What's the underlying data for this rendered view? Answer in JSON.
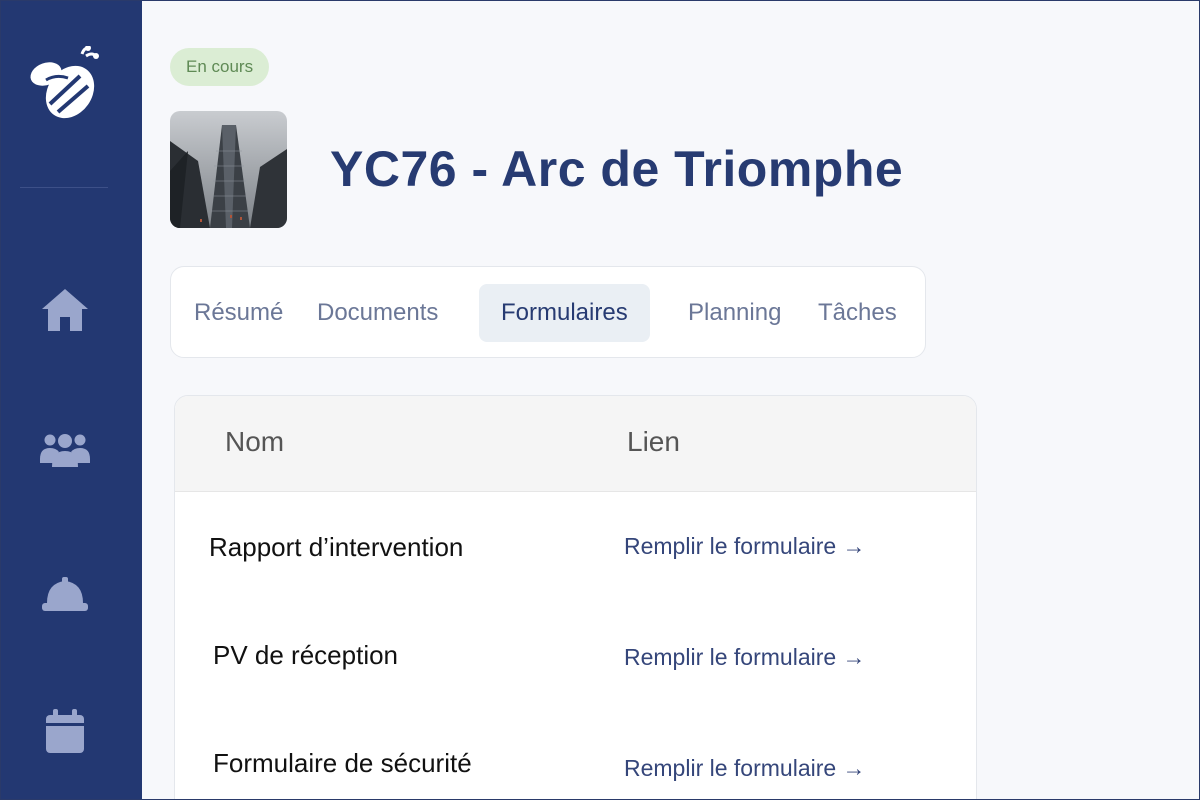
{
  "project": {
    "status": "En cours",
    "title": "YC76 - Arc de Triomphe"
  },
  "sidebar": {
    "items": [
      {
        "icon": "home-icon"
      },
      {
        "icon": "users-icon"
      },
      {
        "icon": "hard-hat-icon"
      },
      {
        "icon": "calendar-icon"
      }
    ]
  },
  "tabs": [
    {
      "label": "Résumé"
    },
    {
      "label": "Documents"
    },
    {
      "label": "Formulaires",
      "active": true
    },
    {
      "label": "Planning"
    },
    {
      "label": "Tâches"
    }
  ],
  "table": {
    "columns": [
      "Nom",
      "Lien"
    ],
    "rows": [
      {
        "name": "Rapport d’intervention",
        "link": "Remplir le formulaire →"
      },
      {
        "name": "PV de réception",
        "link": "Remplir le formulaire →"
      },
      {
        "name": "Formulaire de sécurité",
        "link": "Remplir le formulaire →"
      }
    ]
  },
  "colors": {
    "sidebar": "#233872",
    "accent": "#273b72",
    "status_bg": "#dbedd4",
    "status_text": "#5f8a55",
    "nav_icon": "#9aa6cc"
  }
}
